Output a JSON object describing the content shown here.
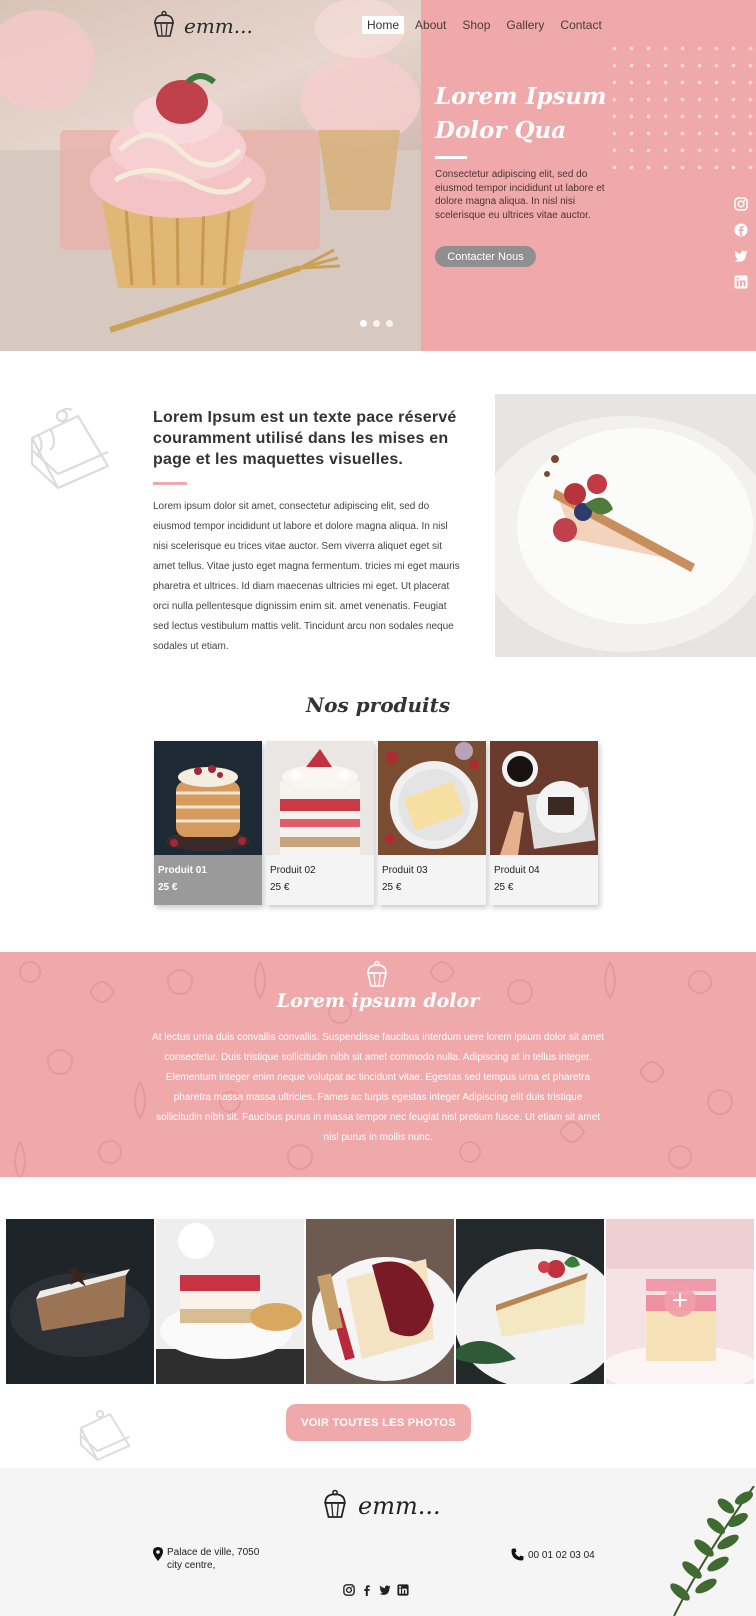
{
  "brand": {
    "name": "emm..."
  },
  "nav": {
    "items": [
      "Home",
      "About",
      "Shop",
      "Gallery",
      "Contact"
    ]
  },
  "hero": {
    "title": "Lorem Ipsum Dolor Qua",
    "text": "Consectetur adipiscing elit, sed do eiusmod tempor incididunt ut labore et dolore magna aliqua. In nisl nisi scelerisque eu ultrices vitae auctor.",
    "button": "Contacter Nous",
    "social_icons": [
      "instagram-icon",
      "facebook-icon",
      "twitter-icon",
      "linkedin-icon"
    ],
    "slides": 3,
    "active_slide": 1
  },
  "intro": {
    "heading": "Lorem Ipsum est un texte pace réservé couramment utilisé dans les mises en page et les maquettes visuelles.",
    "text": "Lorem ipsum dolor sit amet, consectetur adipiscing elit, sed do eiusmod tempor incididunt ut labore et dolore magna aliqua. In nisl nisi scelerisque eu trices vitae auctor. Sem viverra aliquet eget sit amet tellus. Vitae justo eget magna fermentum. tricies mi eget mauris pharetra et ultrices. Id diam maecenas ultricies mi eget. Ut placerat orci nulla pellentesque dignissim enim sit. amet venenatis. Feugiat sed lectus vestibulum mattis  velit. Tincidunt arcu non sodales neque sodales ut etiam."
  },
  "products": {
    "title": "Nos produits",
    "items": [
      {
        "name": "Produit 01",
        "price": "25 €"
      },
      {
        "name": "Produit 02",
        "price": "25 €"
      },
      {
        "name": "Produit 03",
        "price": "25 €"
      },
      {
        "name": "Produit 04",
        "price": "25 €"
      }
    ]
  },
  "band": {
    "title": "Lorem ipsum dolor",
    "text": "At lectus urna duis convallis convallis. Suspendisse faucibus interdum uere lorem ipsum dolor sit amet consectetur. Duis tristique sollicitudin nibh sit amet commodo nulla. Adipiscing at in tellus integer. Elementum integer enim neque volutpat ac tincidunt vitae. Egestas sed tempus urna et pharetra pharetra massa massa ultricies. Fames ac turpis egestas integer Adipiscing elit duis tristique sollicitudin nibh sit. Faucibus purus in massa tempor nec feugiat nisl pretium fusce. Ut etiam sit amet nisl purus in mollis nunc."
  },
  "gallery": {
    "plus": "+",
    "button": "VOIR TOUTES  LES PHOTOS"
  },
  "footer": {
    "brand": "emm...",
    "address_line1": "Palace de ville, 7050",
    "address_line2": "city centre,",
    "phone": "00 01 02 03 04",
    "social_icons": [
      "instagram-icon",
      "facebook-icon",
      "twitter-icon",
      "linkedin-icon"
    ]
  },
  "colors": {
    "accent": "#f0a9ab",
    "button_grey": "#8f8f8f",
    "footer_bg": "#f5f5f5"
  }
}
